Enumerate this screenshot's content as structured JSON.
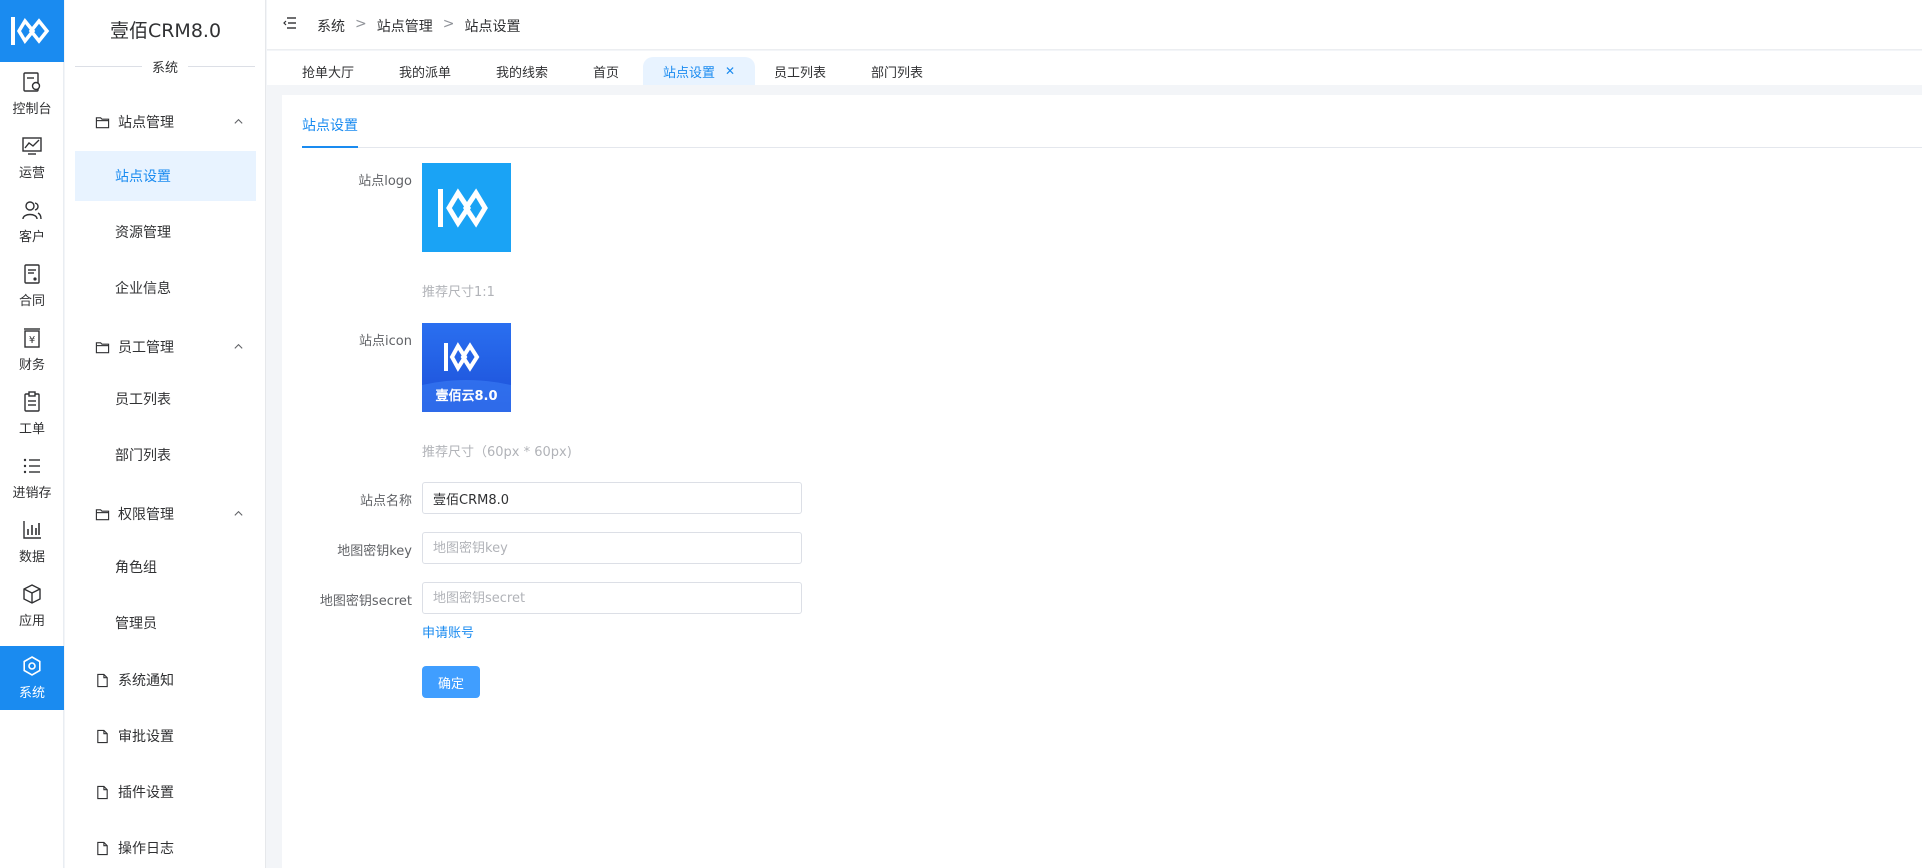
{
  "rail": {
    "items": [
      {
        "label": "控制台",
        "icon": "dashboard-icon"
      },
      {
        "label": "运营",
        "icon": "chart-trend-icon"
      },
      {
        "label": "客户",
        "icon": "customer-icon"
      },
      {
        "label": "合同",
        "icon": "contract-icon"
      },
      {
        "label": "财务",
        "icon": "finance-icon"
      },
      {
        "label": "工单",
        "icon": "ticket-icon"
      },
      {
        "label": "进销存",
        "icon": "list-icon"
      },
      {
        "label": "数据",
        "icon": "bar-chart-icon"
      },
      {
        "label": "应用",
        "icon": "cube-icon"
      },
      {
        "label": "系统",
        "icon": "gear-icon"
      }
    ]
  },
  "sidebar": {
    "title": "壹佰CRM8.0",
    "section": "系统",
    "groups": [
      {
        "label": "站点管理",
        "items": [
          "站点设置",
          "资源管理",
          "企业信息"
        ]
      },
      {
        "label": "员工管理",
        "items": [
          "员工列表",
          "部门列表"
        ]
      },
      {
        "label": "权限管理",
        "items": [
          "角色组",
          "管理员"
        ]
      }
    ],
    "pages": [
      "系统通知",
      "审批设置",
      "插件设置",
      "操作日志"
    ]
  },
  "header": {
    "breadcrumb": [
      "系统",
      "站点管理",
      "站点设置"
    ]
  },
  "tabs": [
    "抢单大厅",
    "我的派单",
    "我的线索",
    "首页",
    "站点设置",
    "员工列表",
    "部门列表"
  ],
  "active_tab": "站点设置",
  "form": {
    "section_tab": "站点设置",
    "logo_label": "站点logo",
    "logo_hint": "推荐尺寸1:1",
    "icon_label": "站点icon",
    "icon_hint": "推荐尺寸（60px * 60px)",
    "icon_caption": "壹佰云8.0",
    "name_label": "站点名称",
    "name_value": "壹佰CRM8.0",
    "map_key_label": "地图密钥key",
    "map_key_placeholder": "地图密钥key",
    "map_secret_label": "地图密钥secret",
    "map_secret_placeholder": "地图密钥secret",
    "apply_link": "申请账号",
    "submit": "确定"
  },
  "colors": {
    "accent": "#1a8bf0",
    "button": "#409eff",
    "active_bg": "#e8f3ff"
  }
}
